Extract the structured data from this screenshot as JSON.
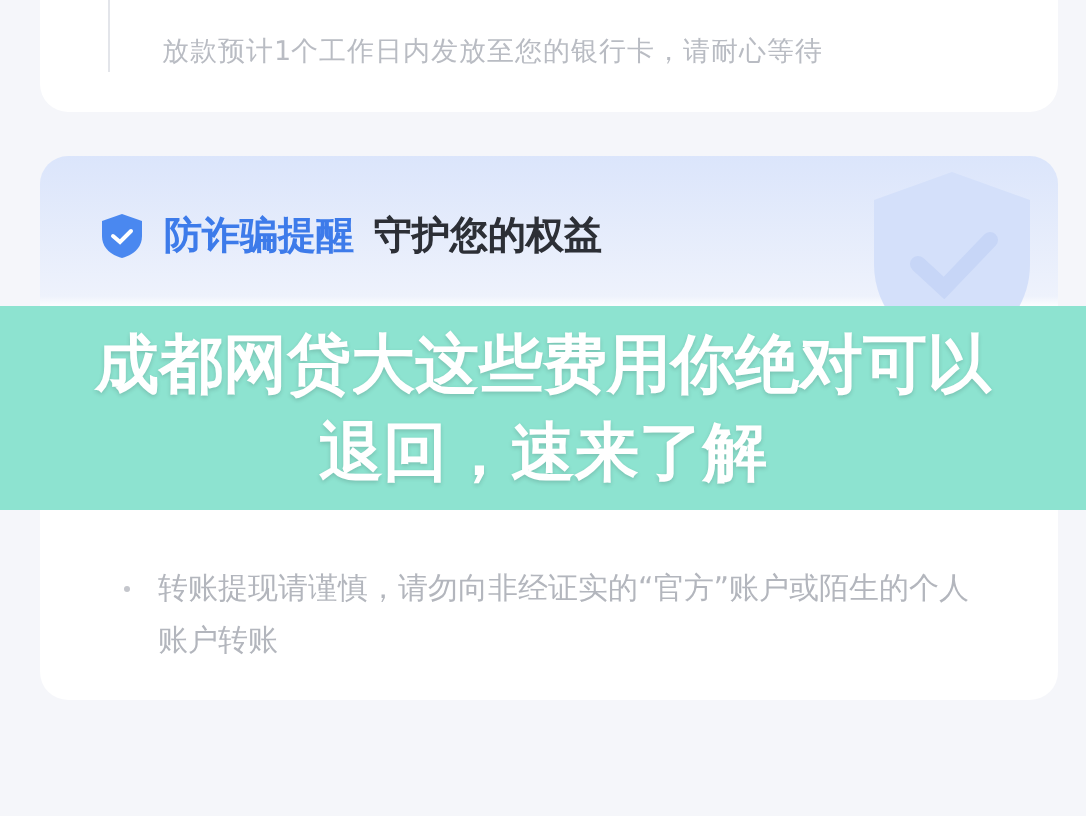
{
  "top_card": {
    "description": "放款预计1个工作日内发放至您的银行卡，请耐心等待"
  },
  "notice": {
    "title_highlight": "防诈骗提醒",
    "title": "守护您的权益",
    "items": [
      "转账提现请谨慎，请勿向非经证实的“官方”账户或陌生的个人账户转账"
    ]
  },
  "banner": {
    "headline": "成都网贷大这些费用你绝对可以退回，速来了解"
  }
}
